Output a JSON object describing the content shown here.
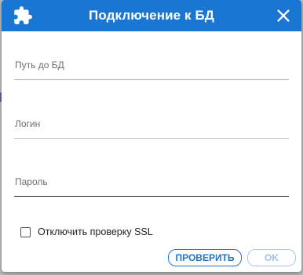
{
  "dialog": {
    "title": "Подключение к БД",
    "icons": {
      "title": "puzzle-piece-icon",
      "close": "close-icon"
    },
    "fields": [
      {
        "label": "Путь до БД",
        "value": ""
      },
      {
        "label": "Логин",
        "value": ""
      },
      {
        "label": "Пароль",
        "value": ""
      }
    ],
    "checkbox": {
      "label": "Отключить проверку SSL",
      "checked": false
    },
    "buttons": {
      "check": "ПРОВЕРИТЬ",
      "ok": "OK"
    }
  },
  "colors": {
    "accent": "#1976d2",
    "title_text": "#ffffff",
    "ok_disabled": "#9fc0e6"
  }
}
